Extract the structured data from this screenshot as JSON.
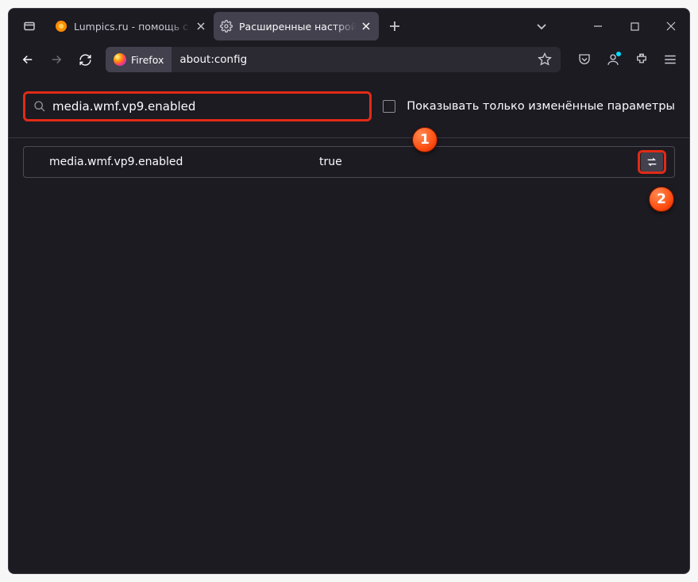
{
  "tabs": [
    {
      "label": "Lumpics.ru - помощь с компью",
      "favicon": "lumpics"
    },
    {
      "label": "Расширенные настройки",
      "favicon": "gear"
    }
  ],
  "urlbar": {
    "identity_label": "Firefox",
    "url": "about:config"
  },
  "page": {
    "search_value": "media.wmf.vp9.enabled",
    "checkbox_label": "Показывать только изменённые параметры",
    "pref": {
      "name": "media.wmf.vp9.enabled",
      "value": "true"
    }
  },
  "callouts": {
    "one": "1",
    "two": "2"
  }
}
